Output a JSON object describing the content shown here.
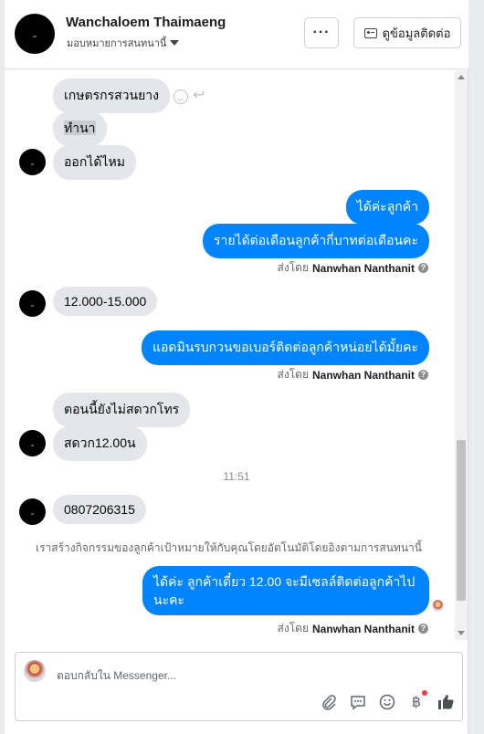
{
  "header": {
    "name": "Wanchaloem Thaimaeng",
    "assign_label": "มอบหมายการสนทนานี้",
    "more_label": "···",
    "contact_label": "ดูข้อมูลติดต่อ"
  },
  "messages": {
    "m1": "เกษตรกรสวนยาง",
    "m2": "ทำนา",
    "m3": "ออกได้ไหม",
    "m4": "ได้ค่ะลูกค้า",
    "m5": "รายได้ต่อเดือนลูกค้ากี่บาทต่อเดือนคะ",
    "m6": "12.000-15.000",
    "m7": "แอดมินรบกวนขอเบอร์ติดต่อลูกค้าหน่อยได้มั้ยคะ",
    "m8": "ตอนนี้ยังไม่สดวกโทร",
    "m9": "สดวก12.00น",
    "m10": "0807206315",
    "m11": "ได้ค่ะ ลูกค้าเดี๋ยว 12.00 จะมีเซลล์ติดต่อลูกค้าไป นะคะ"
  },
  "sent_by_prefix": "ส่งโดย",
  "sent_by_name": "Nanwhan Nanthanit",
  "timestamp": "11:51",
  "system_note": "เราสร้างกิจกรรมของลูกค้าเป้าหมายให้กับคุณโดยอัตโนมัติโดยอิงตามการสนทนานี้",
  "composer": {
    "placeholder": "ตอบกลับใน Messenger..."
  },
  "colors": {
    "outgoing": "#0084ff",
    "incoming": "#e4e6eb"
  }
}
